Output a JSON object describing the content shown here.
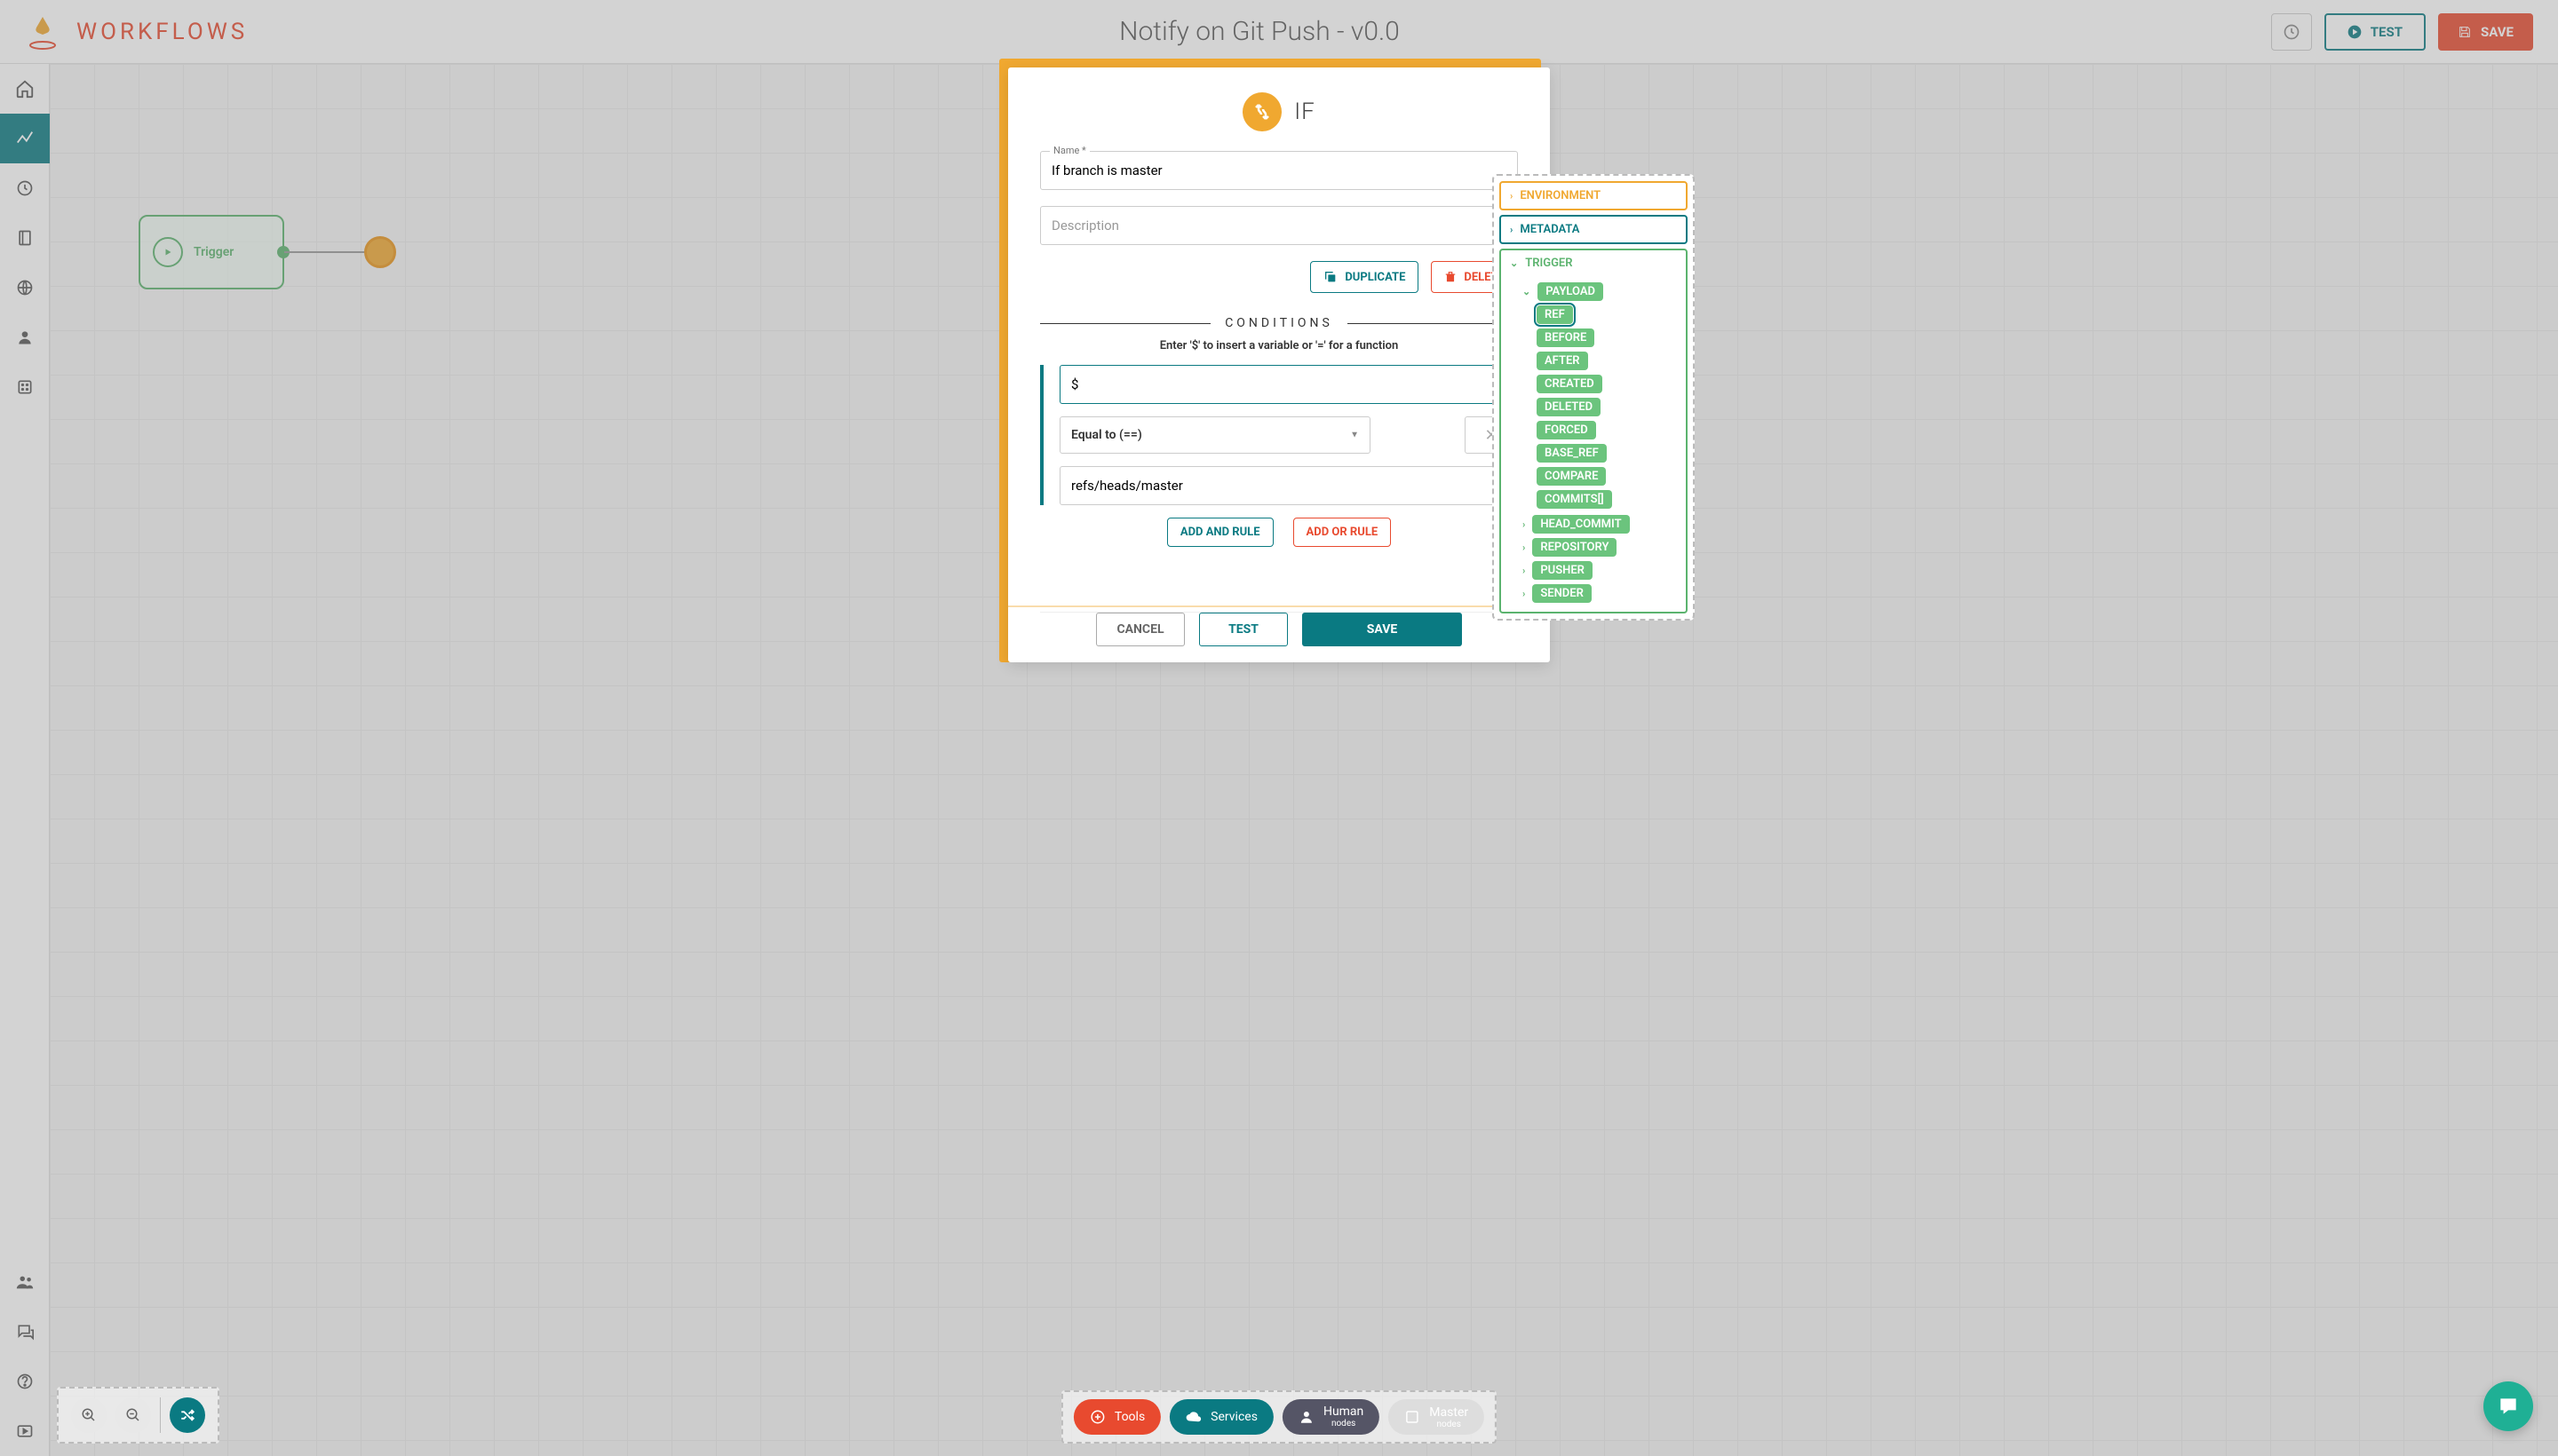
{
  "header": {
    "brand": "WORKFLOWS",
    "title": "Notify on Git Push - v0.0",
    "test": "TEST",
    "save": "SAVE"
  },
  "canvas": {
    "trigger_label": "Trigger"
  },
  "modal": {
    "title": "IF",
    "name_label": "Name *",
    "name_value": "If branch is master",
    "description_placeholder": "Description",
    "duplicate": "DUPLICATE",
    "delete": "DELETE",
    "conditions_heading": "CONDITIONS",
    "hint": "Enter '$' to insert a variable or '=' for a function",
    "lhs_value": "$",
    "operator": "Equal to (==)",
    "rhs_value": "refs/heads/master",
    "add_and": "ADD AND RULE",
    "add_or": "ADD OR RULE",
    "cancel": "CANCEL",
    "test": "TEST",
    "save": "SAVE"
  },
  "vars": {
    "environment": "ENVIRONMENT",
    "metadata": "METADATA",
    "trigger": "TRIGGER",
    "payload": "PAYLOAD",
    "leaves": [
      "REF",
      "BEFORE",
      "AFTER",
      "CREATED",
      "DELETED",
      "FORCED",
      "BASE_REF",
      "COMPARE",
      "COMMITS[]"
    ],
    "expandable": [
      "HEAD_COMMIT",
      "REPOSITORY",
      "PUSHER",
      "SENDER"
    ]
  },
  "bottom": {
    "tools": "Tools",
    "services": "Services",
    "human": "Human",
    "nodes": "nodes",
    "master": "Master"
  }
}
